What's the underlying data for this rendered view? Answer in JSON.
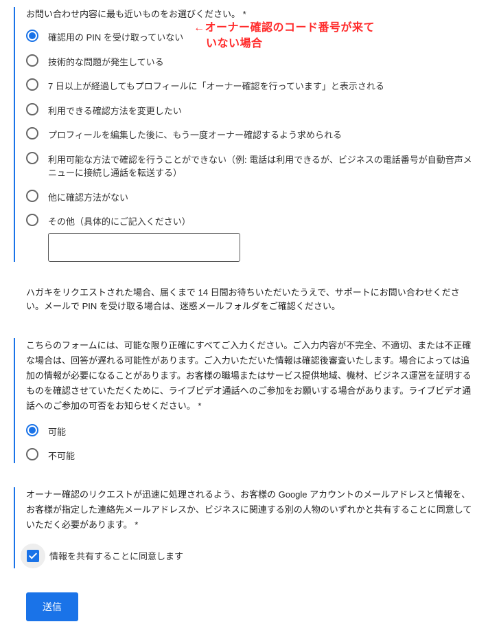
{
  "section1": {
    "question": "お問い合わせ内容に最も近いものをお選びください。 *",
    "options": [
      "確認用の PIN を受け取っていない",
      "技術的な問題が発生している",
      "7 日以上が経過してもプロフィールに「オーナー確認を行っています」と表示される",
      "利用できる確認方法を変更したい",
      "プロフィールを編集した後に、もう一度オーナー確認するよう求められる",
      "利用可能な方法で確認を行うことができない（例: 電話は利用できるが、ビジネスの電話番号が自動音声メニューに接続し通話を転送する）",
      "他に確認方法がない",
      "その他（具体的にご記入ください）"
    ],
    "other_value": ""
  },
  "info": "ハガキをリクエストされた場合、届くまで 14 日間お待ちいただいたうえで、サポートにお問い合わせください。メールで PIN を受け取る場合は、迷惑メールフォルダをご確認ください。",
  "section2": {
    "desc": "こちらのフォームには、可能な限り正確にすべてご入力ください。ご入力内容が不完全、不適切、または不正確な場合は、回答が遅れる可能性があります。ご入力いただいた情報は確認後審査いたします。場合によっては追加の情報が必要になることがあります。お客様の職場またはサービス提供地域、機材、ビジネス運営を証明するものを確認させていただくために、ライブビデオ通話へのご参加をお願いする場合があります。ライブビデオ通話へのご参加の可否をお知らせください。 *",
    "options": [
      "可能",
      "不可能"
    ]
  },
  "section3": {
    "desc": "オーナー確認のリクエストが迅速に処理されるよう、お客様の Google アカウントのメールアドレスと情報を、お客様が指定した連絡先メールアドレスか、ビジネスに関連する別の人物のいずれかと共有することに同意していただく必要があります。 *",
    "checkbox_label": "情報を共有することに同意します"
  },
  "submit": "送信",
  "annotation": {
    "line1": "←オーナー確認のコード番号が来て",
    "line2": "いない場合"
  }
}
